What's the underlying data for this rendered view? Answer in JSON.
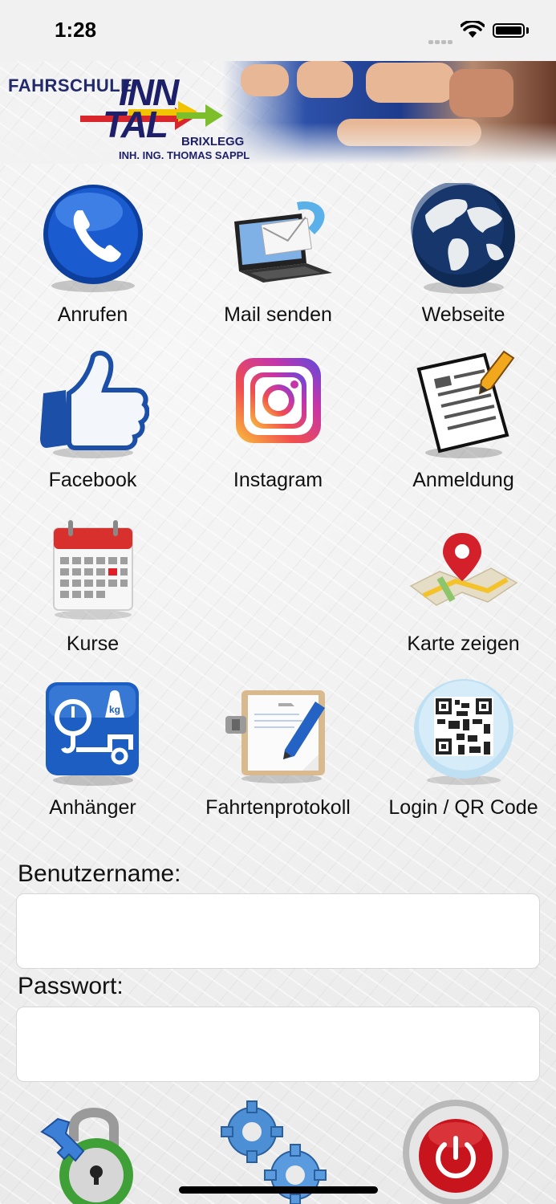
{
  "status_bar": {
    "time": "1:28"
  },
  "header": {
    "logo_school": "FAHRSCHULE",
    "logo_line1": "INN",
    "logo_line2": "TAL",
    "logo_place": "BRIXLEGG",
    "logo_owner": "INH. ING. THOMAS SAPPL"
  },
  "menu": [
    {
      "label": "Anrufen",
      "icon": "phone-icon"
    },
    {
      "label": "Mail senden",
      "icon": "laptop-mail-icon"
    },
    {
      "label": "Webseite",
      "icon": "globe-icon"
    },
    {
      "label": "Facebook",
      "icon": "thumbs-up-icon"
    },
    {
      "label": "Instagram",
      "icon": "instagram-icon"
    },
    {
      "label": "Anmeldung",
      "icon": "form-pencil-icon"
    },
    {
      "label": "Kurse",
      "icon": "calendar-icon"
    },
    {
      "label": "Karte zeigen",
      "icon": "map-pin-icon"
    },
    {
      "label": "Anhänger",
      "icon": "trailer-weight-icon"
    },
    {
      "label": "Fahrtenprotokoll",
      "icon": "clipboard-pen-icon"
    },
    {
      "label": "Login / QR Code",
      "icon": "qr-code-icon"
    }
  ],
  "form": {
    "username_label": "Benutzername:",
    "username_value": "",
    "password_label": "Passwort:",
    "password_value": ""
  },
  "bottom_actions": [
    {
      "icon": "padlock-key-icon"
    },
    {
      "icon": "gears-icon"
    },
    {
      "icon": "power-icon"
    }
  ],
  "colors": {
    "brand_navy": "#1d1f6b",
    "power_red": "#c8141c",
    "icon_blue": "#1a5bb8"
  }
}
